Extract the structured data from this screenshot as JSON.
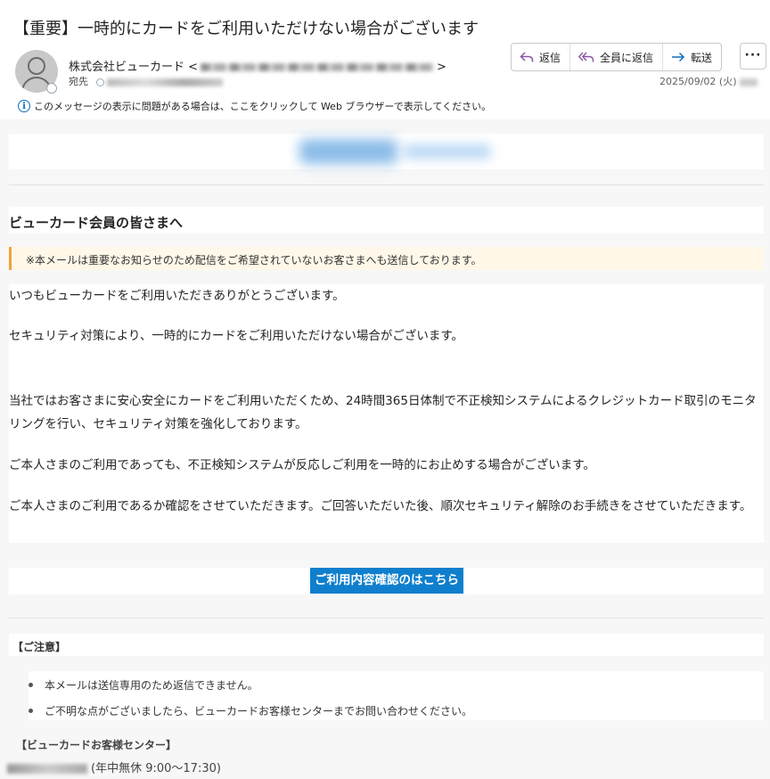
{
  "email": {
    "subject": "【重要】一時的にカードをご利用いただけない場合がございます",
    "sender_name": "株式会社ビューカード <",
    "sender_close": ">",
    "to_label": "宛先",
    "date": "2025/09/02 (火)",
    "info_message": "このメッセージの表示に問題がある場合は、ここをクリックして Web ブラウザーで表示してください。"
  },
  "toolbar": {
    "reply": "返信",
    "reply_all": "全員に返信",
    "forward": "転送",
    "more": "···"
  },
  "body": {
    "greeting": "ビューカード会員の皆さまへ",
    "notice": "※本メールは重要なお知らせのため配信をご希望されていないお客さまへも送信しております。",
    "paragraphs": [
      "いつもビューカードをご利用いただきありがとうございます。",
      "セキュリティ対策により、一時的にカードをご利用いただけない場合がございます。",
      "当社ではお客さまに安心安全にカードをご利用いただくため、24時間365日体制で不正検知システムによるクレジットカード取引のモニタリングを行い、セキュリティ対策を強化しております。",
      "ご本人さまのご利用であっても、不正検知システムが反応しご利用を一時的にお止めする場合がございます。",
      "ご本人さまのご利用であるか確認をさせていただきます。ご回答いただいた後、順次セキュリティ解除のお手続きをさせていただきます。"
    ],
    "cta": "ご利用内容確認のはこちら",
    "caution_title": "【ご注意】",
    "caution_items": [
      "本メールは送信専用のため返信できません。",
      "ご不明な点がございましたら、ビューカードお客様センターまでお問い合わせください。"
    ],
    "center_title": "【ビューカードお客様センター】",
    "hours": "(年中無休 9:00～17:30)"
  },
  "colors": {
    "accent": "#0f6cbd",
    "cta_bg": "#0f7fcd",
    "notice_border": "#f0a43a",
    "notice_bg": "#fff8e8"
  }
}
